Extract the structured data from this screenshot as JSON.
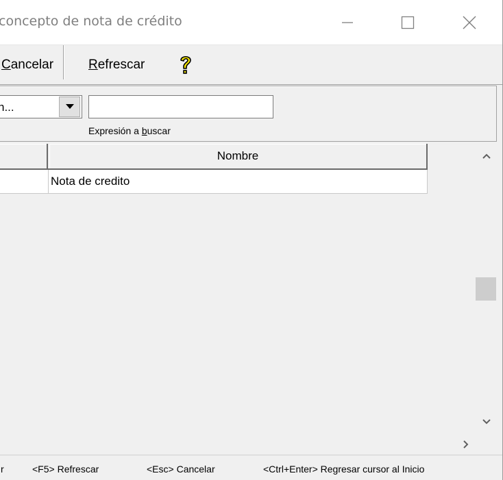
{
  "window": {
    "title": "concepto de nota de crédito",
    "controls": {
      "minimize_icon": "minimize-icon",
      "maximize_icon": "maximize-icon",
      "close_icon": "close-icon"
    }
  },
  "toolbar": {
    "cancel": {
      "underlined": "C",
      "rest": "ancelar"
    },
    "refresh": {
      "underlined": "R",
      "rest": "efrescar"
    },
    "help_icon": "question-mark-help-icon",
    "help_color": "#e8d800"
  },
  "search": {
    "field_value": "n...",
    "dropdown_icon": "dropdown-arrow-icon",
    "input_value": "",
    "caption_before": "Expresión a ",
    "caption_underlined": "b",
    "caption_after": "uscar"
  },
  "grid": {
    "columns": [
      "",
      "Nombre"
    ],
    "rows": [
      {
        "col0": "",
        "nombre": "Nota de credito"
      }
    ]
  },
  "scrollbars": {
    "up_icon": "scroll-up-icon",
    "down_icon": "scroll-down-icon",
    "right_icon": "scroll-right-icon"
  },
  "statusbar": {
    "items": [
      "r",
      "<F5> Refrescar",
      "<Esc> Cancelar",
      "<Ctrl+Enter> Regresar cursor al Inicio"
    ]
  }
}
